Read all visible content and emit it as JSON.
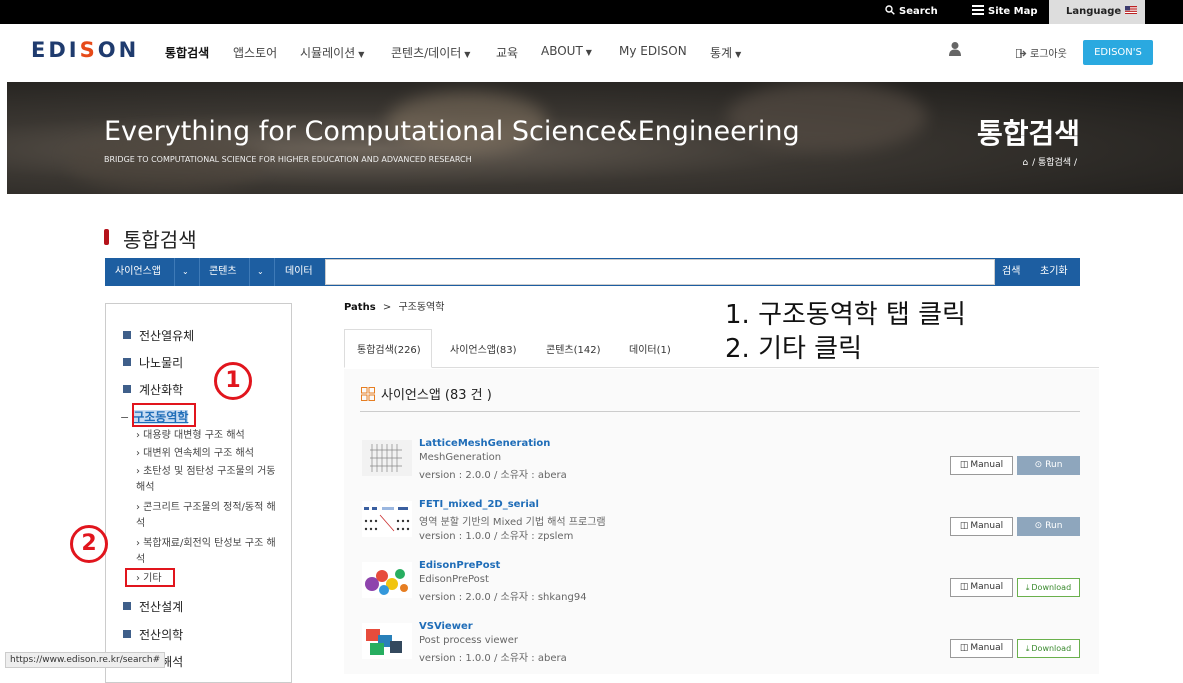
{
  "topbar": {
    "search": "Search",
    "sitemap": "Site Map",
    "language": "Language"
  },
  "nav": {
    "logo_pre": "EDI",
    "logo_mid": "S",
    "logo_o": "O",
    "logo_post": "N",
    "items": [
      "통합검색",
      "앱스토어",
      "시뮬레이션",
      "콘텐츠/데이터",
      "교육",
      "ABOUT",
      "My EDISON",
      "통계"
    ],
    "logout": "로그아웃",
    "edisons": "EDISON'S"
  },
  "hero": {
    "title": "Everything for Computational Science&Engineering",
    "subtitle": "BRIDGE TO COMPUTATIONAL SCIENCE FOR HIGHER EDUCATION AND ADVANCED RESEARCH",
    "right_title": "통합검색",
    "crumb": "/ 통합검색 /"
  },
  "page_title": "통합검색",
  "searchbar": {
    "seg1": "사이언스앱",
    "seg2": "콘텐츠",
    "seg3": "데이터",
    "search_btn": "검색",
    "reset_btn": "초기화",
    "input_value": ""
  },
  "sidebar": {
    "cats": [
      "전산열유체",
      "나노물리",
      "계산화학",
      "구조동역학",
      "전산설계",
      "전산의학",
      "유동해석"
    ],
    "subs": [
      "› 대용량 대변형 구조 해석",
      "› 대변위 연속체의 구조 해석",
      "› 초탄성 및 점탄성 구조물의 거동 해석",
      "› 콘크리트 구조물의 정적/동적 해석",
      "› 복합재료/회전익 탄성보 구조 해석",
      "› 기타"
    ]
  },
  "annotation": {
    "circle1": "1",
    "circle2": "2",
    "step1": "1. 구조동역학 탭 클릭",
    "step2": "2. 기타 클릭"
  },
  "paths": {
    "label": "Paths",
    "sep": ">",
    "value": "구조동역학"
  },
  "tabs": [
    "통합검색(226)",
    "사이언스앱(83)",
    "콘텐츠(142)",
    "데이터(1)"
  ],
  "panel": {
    "title": "사이언스앱 (83 건 )",
    "rows": [
      {
        "name": "LatticeMeshGeneration",
        "desc": "MeshGeneration",
        "ver": "version : 2.0.0 / 소유자 : abera",
        "manual": "Manual",
        "action": "Run"
      },
      {
        "name": "FETI_mixed_2D_serial",
        "desc": "영역 분할 기반의 Mixed 기법 해석 프로그램",
        "ver": "version : 1.0.0 / 소유자 : zpslem",
        "manual": "Manual",
        "action": "Run"
      },
      {
        "name": "EdisonPrePost",
        "desc": "EdisonPrePost",
        "ver": "version : 2.0.0 / 소유자 : shkang94",
        "manual": "Manual",
        "action": "Download"
      },
      {
        "name": "VSViewer",
        "desc": "Post process viewer",
        "ver": "version : 1.0.0 / 소유자 : abera",
        "manual": "Manual",
        "action": "Download"
      }
    ]
  },
  "status_url": "https://www.edison.re.kr/search#",
  "colors": {
    "brand_blue": "#1d5ea1",
    "accent_red": "#e1151d",
    "cyan": "#2aa9e0"
  }
}
